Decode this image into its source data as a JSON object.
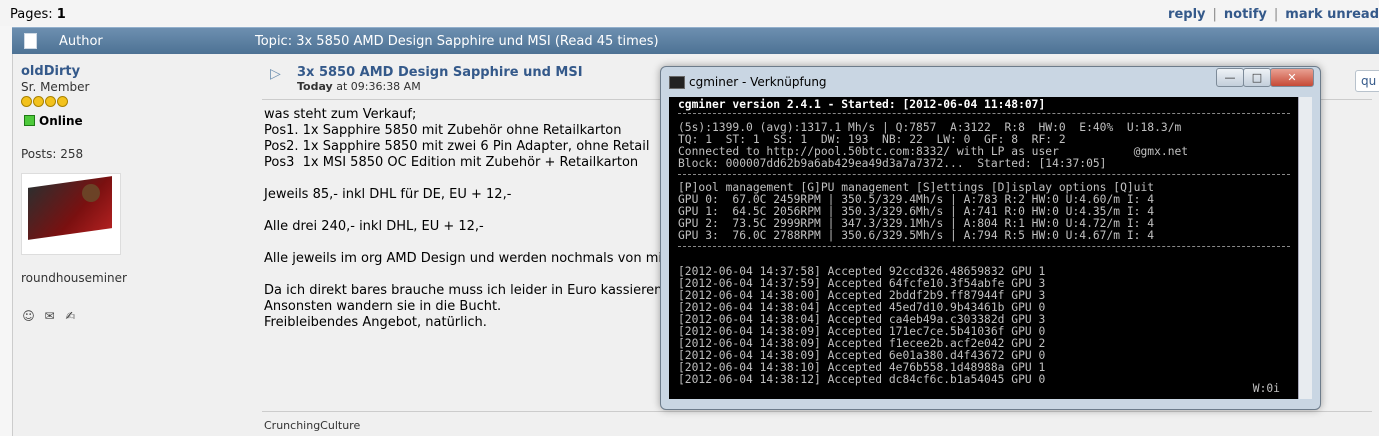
{
  "pages": {
    "label": "Pages:",
    "current": "1"
  },
  "top_links": [
    "reply",
    "notify",
    "mark unread"
  ],
  "header": {
    "author": "Author",
    "topic": "Topic: 3x 5850 AMD Design Sapphire und MSI  (Read 45 times)"
  },
  "poster": {
    "name": "oldDirty",
    "rank": "Sr. Member",
    "stars": 4,
    "status": "Online",
    "posts": "Posts: 258",
    "signature_name": "roundhouseminer"
  },
  "post": {
    "subject": "3x 5850 AMD Design Sapphire und MSI",
    "date_bold": "Today",
    "date_rest": " at 09:36:38 AM",
    "quote_label": "qu",
    "body": "was steht zum Verkauf;\nPos1. 1x Sapphire 5850 mit Zubehör ohne Retailkarton\nPos2. 1x Sapphire 5850 mit zwei 6 Pin Adapter, ohne Retail\nPos3  1x MSI 5850 OC Edition mit Zubehör + Retailkarton\n\nJeweils 85,- inkl DHL für DE, EU + 12,-\n\nAlle drei 240,- inkl DHL, EU + 12,-\n\nAlle jeweils im org AMD Design und werden nochmals von mi\n\nDa ich direkt bares brauche muss ich leider in Euro kassieren\nAnsonsten wandern sie in die Bucht.\nFreibleibendes Angebot, natürlich.",
    "signature": "CrunchingCulture"
  },
  "window": {
    "title": "cgminer - Verknüpfung",
    "buttons": [
      "minimize",
      "maximize",
      "close"
    ]
  },
  "terminal": {
    "version_line": "cgminer version 2.4.1 - Started: [2012-06-04 11:48:07]",
    "status": [
      "(5s):1399.0 (avg):1317.1 Mh/s | Q:7857  A:3122  R:8  HW:0  E:40%  U:18.3/m",
      "TQ: 1  ST: 1  SS: 1  DW: 193  NB: 22  LW: 0  GF: 8  RF: 2",
      "Connected to http://pool.50btc.com:8332/ with LP as user           @gmx.net",
      "Block: 000007dd62b9a6ab429ea49d3a7a7372...  Started: [14:37:05]"
    ],
    "menu": "[P]ool management [G]PU management [S]ettings [D]isplay options [Q]uit",
    "gpus": [
      "GPU 0:  67.0C 2459RPM | 350.5/329.4Mh/s | A:783 R:2 HW:0 U:4.60/m I: 4",
      "GPU 1:  64.5C 2056RPM | 350.3/329.6Mh/s | A:741 R:0 HW:0 U:4.35/m I: 4",
      "GPU 2:  73.5C 2999RPM | 347.3/329.1Mh/s | A:804 R:1 HW:0 U:4.72/m I: 4",
      "GPU 3:  76.0C 2788RPM | 350.6/329.5Mh/s | A:794 R:5 HW:0 U:4.67/m I: 4"
    ],
    "log": [
      "[2012-06-04 14:37:58] Accepted 92ccd326.48659832 GPU 1",
      "[2012-06-04 14:37:59] Accepted 64fcfe10.3f54abfe GPU 3",
      "[2012-06-04 14:38:00] Accepted 2bddf2b9.ff87944f GPU 3",
      "[2012-06-04 14:38:04] Accepted 45ed7d10.9b43461b GPU 0",
      "[2012-06-04 14:38:04] Accepted ca4eb49a.c303382d GPU 3",
      "[2012-06-04 14:38:09] Accepted 171ec7ce.5b41036f GPU 0",
      "[2012-06-04 14:38:09] Accepted f1ecee2b.acf2e042 GPU 2",
      "[2012-06-04 14:38:09] Accepted 6e01a380.d4f43672 GPU 0",
      "[2012-06-04 14:38:10] Accepted 4e76b558.1d48988a GPU 1",
      "[2012-06-04 14:38:12] Accepted dc84cf6c.b1a54045 GPU 0"
    ],
    "corner": "W:0i"
  }
}
